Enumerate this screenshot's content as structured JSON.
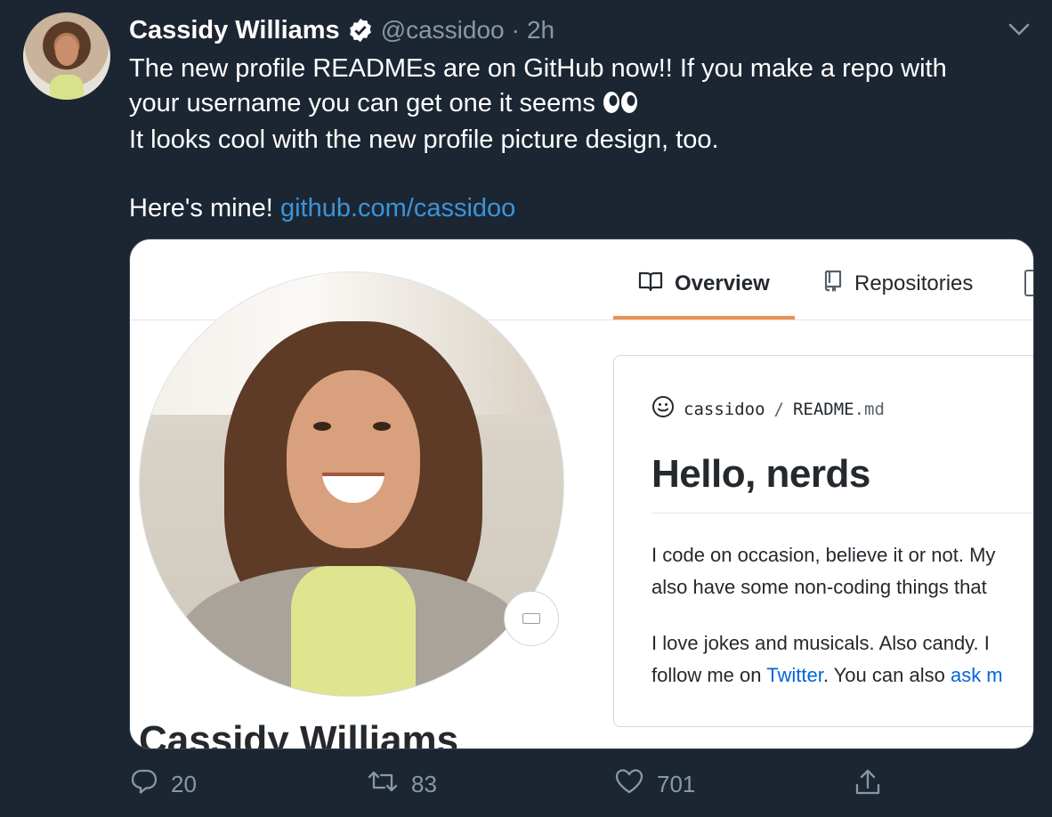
{
  "tweet": {
    "author_name": "Cassidy Williams",
    "handle": "@cassidoo",
    "separator": "·",
    "time": "2h",
    "text_line1": "The new profile READMEs are on GitHub now!! If you make a repo with",
    "text_line2": "your username you can get one it seems",
    "text_line3": "It looks cool with the new profile picture design, too.",
    "text_line4_prefix": "Here's mine!",
    "link": "github.com/cassidoo",
    "reply_count": "20",
    "retweet_count": "83",
    "like_count": "701",
    "colors": {
      "background": "#1c2633",
      "link": "#3b94d9",
      "muted": "#8899a6"
    }
  },
  "card": {
    "tabs": [
      {
        "label": "Overview",
        "icon": "book-icon",
        "selected": true
      },
      {
        "label": "Repositories",
        "icon": "repo-icon",
        "selected": false
      }
    ],
    "profile_name": "Cassidy Williams",
    "readme": {
      "path_owner": "cassidoo",
      "path_sep": "/",
      "path_file": "README",
      "path_ext": ".md",
      "heading": "Hello, nerds",
      "p1_line1": "I code on occasion, believe it or not. My",
      "p1_line2": "also have some non-coding things that",
      "p2_line1": "I love jokes and musicals. Also candy. I",
      "p2_line2_pre": "follow me on",
      "p2_line2_link": "Twitter",
      "p2_line2_mid": ". You can also",
      "p2_line2_link2": "ask m"
    }
  }
}
